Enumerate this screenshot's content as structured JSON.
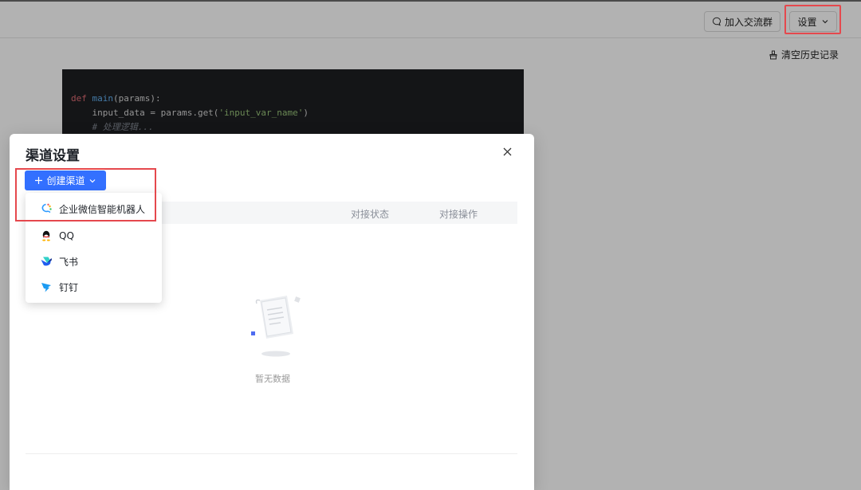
{
  "header": {
    "join_group_label": "加入交流群",
    "settings_label": "设置",
    "clear_history_label": "清空历史记录"
  },
  "code": {
    "lines": {
      "l1_kw": "def",
      "l1_fn": "main",
      "l1_rest": "(params):",
      "l2_a": "    input_data = params.get(",
      "l2_str": "'input_var_name'",
      "l2_b": ")",
      "l3_comment": "    # 处理逻辑..."
    }
  },
  "modal": {
    "title": "渠道设置",
    "create_button_label": "创建渠道",
    "table": {
      "columns": [
        "对接状态",
        "对接操作"
      ]
    },
    "empty_text": "暂无数据"
  },
  "dropdown": {
    "items": [
      {
        "label": "企业微信智能机器人",
        "icon": "wecom-icon"
      },
      {
        "label": "QQ",
        "icon": "qq-icon"
      },
      {
        "label": "飞书",
        "icon": "feishu-icon"
      },
      {
        "label": "钉钉",
        "icon": "dingtalk-icon"
      }
    ]
  },
  "colors": {
    "primary": "#3370ff",
    "highlight": "#e5484d"
  }
}
